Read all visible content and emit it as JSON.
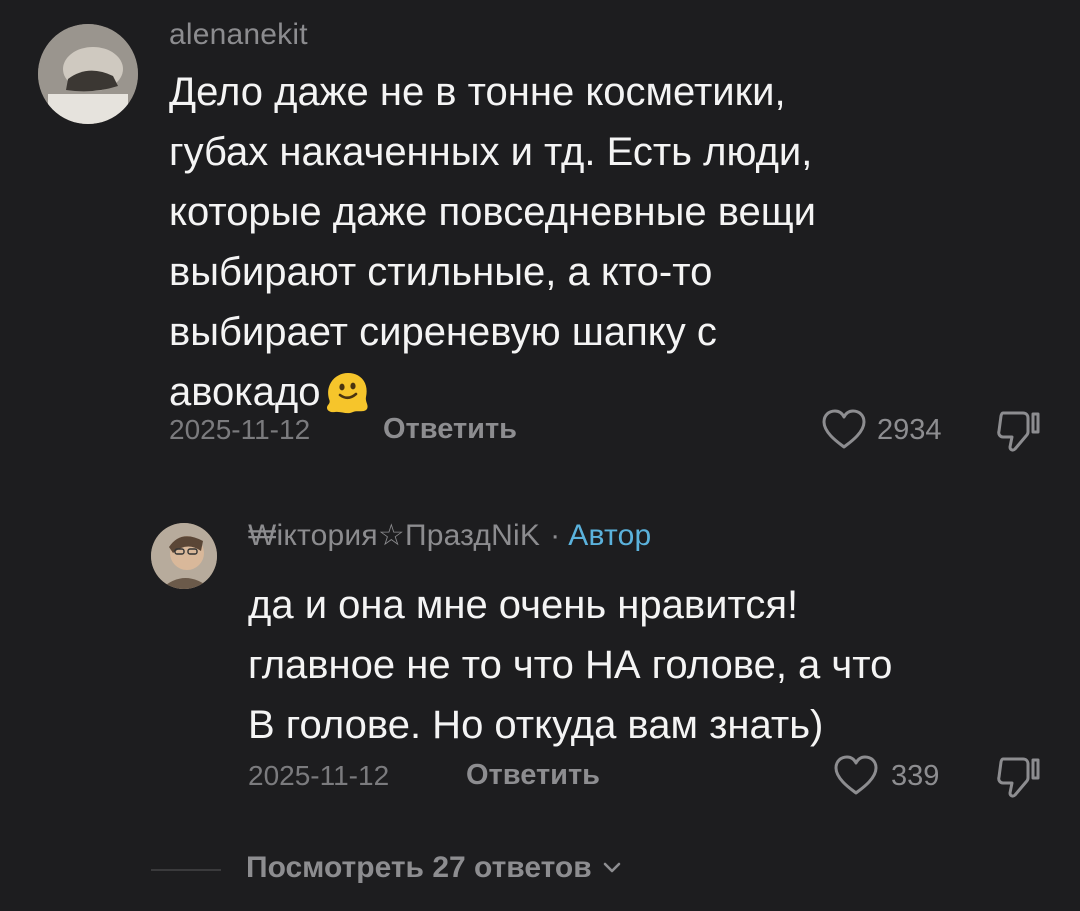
{
  "comments": [
    {
      "username": "alenanekit",
      "text_lines": [
        "Дело даже не в тонне косметики,",
        "губах накаченных и тд. Есть люди,",
        "которые даже повседневные вещи",
        "выбирают стильные, а кто-то",
        "выбирает сиреневую шапку с",
        "авокадо"
      ],
      "date": "2025-11-12",
      "reply_label": "Ответить",
      "likes": "2934",
      "emoji": "melting-face-emoji"
    }
  ],
  "reply": {
    "username": "₩iкторияПраздNiK",
    "author_badge": "Автор",
    "separator": "·",
    "text_lines": [
      "да и она мне очень нравится!",
      "главное не то что НА голове, а что",
      "В голове. Но откуда вам знать)"
    ],
    "date": "2025-11-12",
    "reply_label": "Ответить",
    "likes": "339"
  },
  "view_replies": {
    "label": "Посмотреть 27 ответов"
  },
  "colors": {
    "background": "#1d1d1f",
    "text": "#f4f4f4",
    "muted": "#8d8d90",
    "author": "#5bb2dc"
  },
  "icons": [
    "heart-icon",
    "dislike-icon",
    "chevron-down-icon",
    "star-icon"
  ]
}
